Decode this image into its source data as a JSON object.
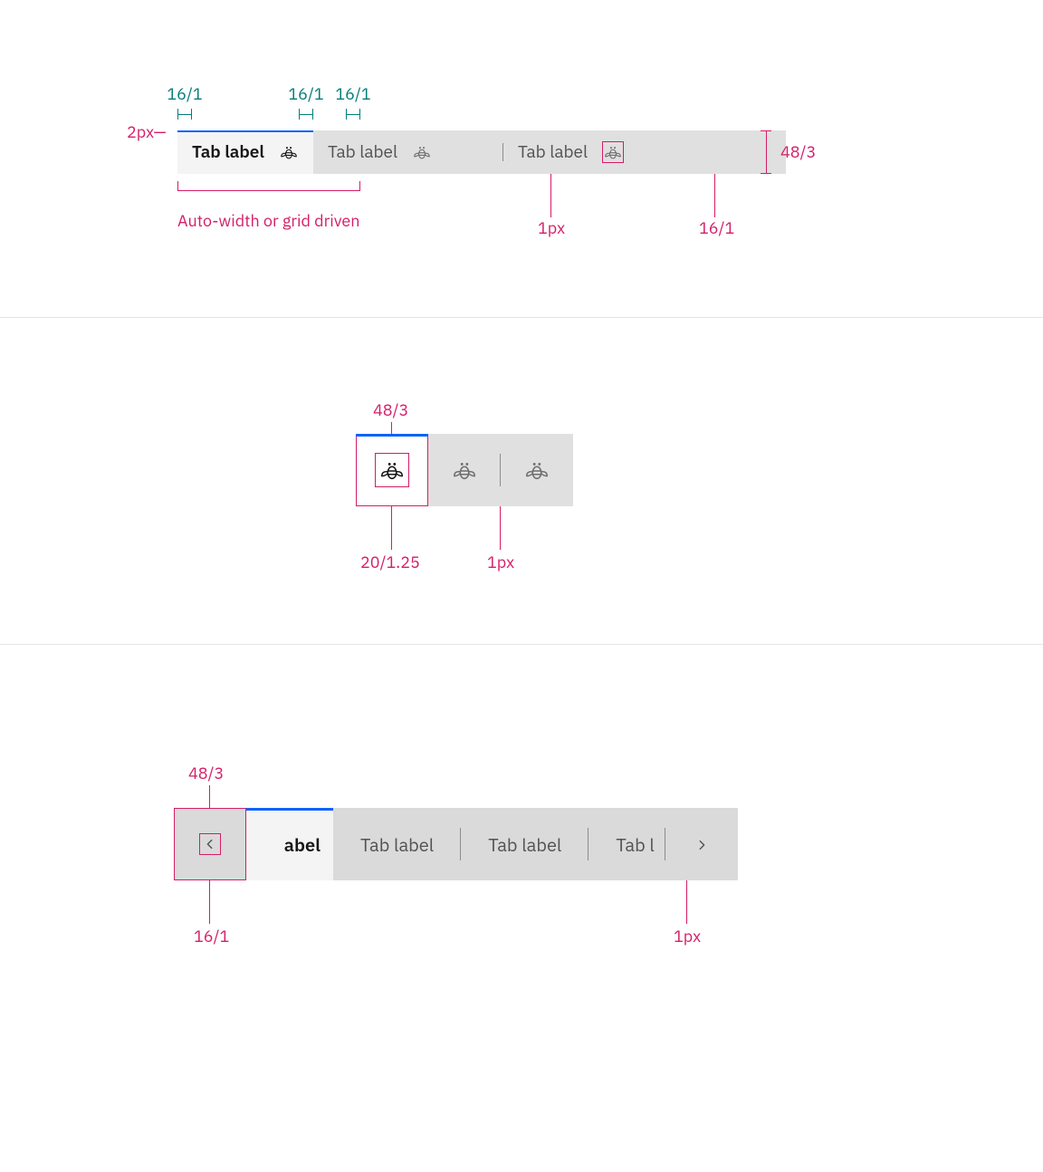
{
  "figure1": {
    "spacing_values": [
      "16/1",
      "16/1",
      "16/1"
    ],
    "top_border_label": "2px—",
    "tabs": [
      {
        "label": "Tab label",
        "selected": true
      },
      {
        "label": "Tab label",
        "selected": false
      },
      {
        "label": "Tab label",
        "selected": false
      }
    ],
    "height_label": "48/3",
    "bottom_note": "Auto-width or grid driven",
    "divider_label": "1px",
    "icon_size_label": "16/1"
  },
  "figure2": {
    "size_label": "48/3",
    "icon_label": "20/1.25",
    "divider_label": "1px",
    "icon_tabs": [
      {
        "selected": true
      },
      {
        "selected": false
      },
      {
        "selected": false
      }
    ]
  },
  "figure3": {
    "button_size_label": "48/3",
    "chevron_label": "16/1",
    "divider_label": "1px",
    "visible_selected_fragment": "abel",
    "tabs": [
      "Tab label",
      "Tab label",
      "Tab l"
    ]
  }
}
